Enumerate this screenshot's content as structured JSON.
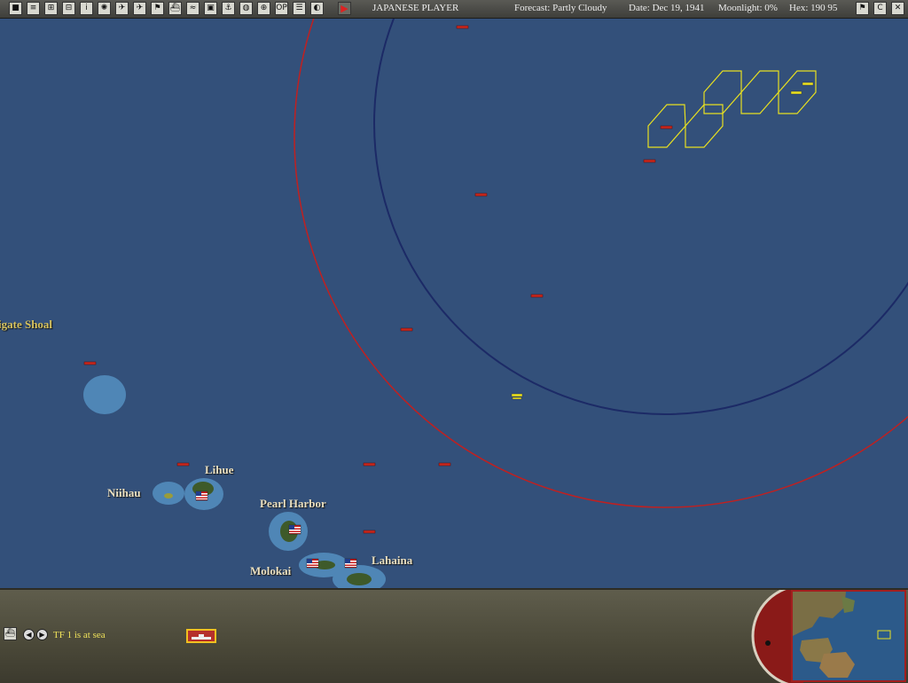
{
  "toolbar": {
    "buttons": [
      {
        "name": "game-menu-button",
        "glyph": "■"
      },
      {
        "name": "report-button",
        "glyph": "≡"
      },
      {
        "name": "bases-button",
        "glyph": "⊞"
      },
      {
        "name": "ships-button",
        "glyph": "⊟"
      },
      {
        "name": "info-button",
        "glyph": "i"
      },
      {
        "name": "japan-flag-button",
        "glyph": "✺"
      },
      {
        "name": "air-red-button",
        "glyph": "✈"
      },
      {
        "name": "air-blue-button",
        "glyph": "✈"
      },
      {
        "name": "flag-button",
        "glyph": "⚑"
      },
      {
        "name": "ship-button",
        "glyph": "⛴"
      },
      {
        "name": "route-button",
        "glyph": "≈"
      },
      {
        "name": "map-button",
        "glyph": "▣"
      },
      {
        "name": "fleet-button",
        "glyph": "⚓"
      },
      {
        "name": "globe-button",
        "glyph": "◍"
      },
      {
        "name": "cycle-button",
        "glyph": "⊕"
      },
      {
        "name": "ops-button",
        "glyph": "OP"
      },
      {
        "name": "list-button",
        "glyph": "☰"
      },
      {
        "name": "weather-button",
        "glyph": "◐"
      }
    ],
    "player": "JAPANESE PLAYER",
    "forecast": "Forecast: Partly Cloudy",
    "date": "Date: Dec 19, 1941",
    "moonlight": "Moonlight: 0%",
    "hex": "Hex: 190 95",
    "right_buttons": [
      {
        "name": "flag-right-button",
        "glyph": "⚑"
      },
      {
        "name": "c-button",
        "glyph": "C"
      },
      {
        "name": "close-button",
        "glyph": "✕"
      }
    ]
  },
  "map": {
    "labels": {
      "frigate_shoal": "igate Shoal",
      "lihue": "Lihue",
      "niihau": "Niihau",
      "pearl_harbor": "Pearl Harbor",
      "molokai": "Molokai",
      "lahaina": "Lahaina"
    }
  },
  "bottom": {
    "status": "TF 1 is at sea"
  },
  "colors": {
    "ocean": "#33507a",
    "red_ring": "#c02020",
    "blue_ring": "#1c2a66",
    "hex": "#e8e020",
    "ship": "#c8281e"
  }
}
